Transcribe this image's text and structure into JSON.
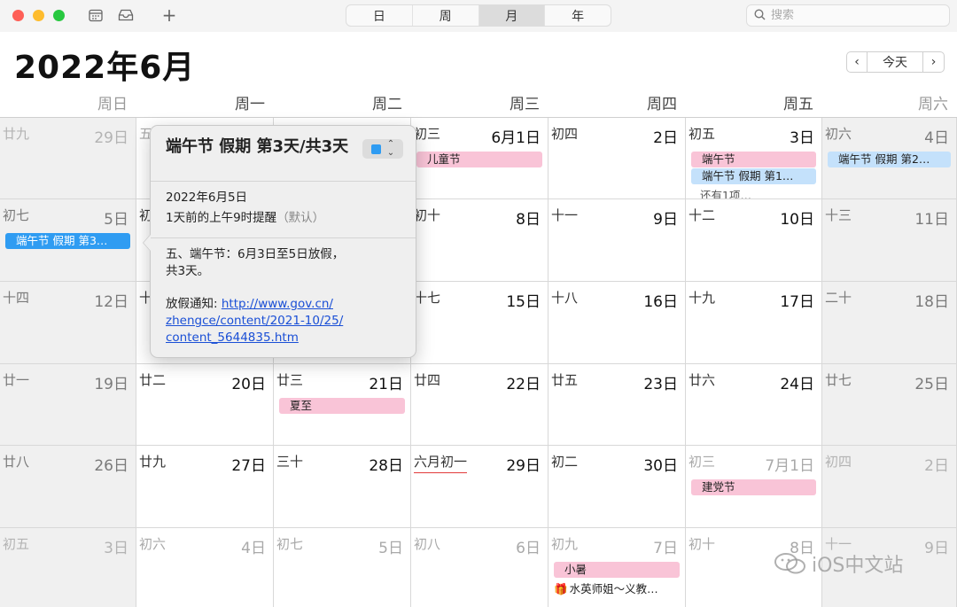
{
  "toolbar": {
    "view_tabs": [
      "日",
      "周",
      "月",
      "年"
    ],
    "active_view": "月",
    "search_placeholder": "搜索",
    "add_label": "+"
  },
  "header": {
    "month_title": "2022年6月",
    "today_label": "今天",
    "prev_label": "‹",
    "next_label": "›"
  },
  "weekdays": [
    "周日",
    "周一",
    "周二",
    "周三",
    "周四",
    "周五",
    "周六"
  ],
  "weeks": [
    [
      {
        "lunar": "廿九",
        "day": "29日",
        "other": true,
        "events": []
      },
      {
        "lunar": "五",
        "day": "",
        "other": true,
        "events": []
      },
      {
        "lunar": "",
        "day": "",
        "other": true,
        "events": []
      },
      {
        "lunar": "初三",
        "day": "6月1日",
        "events": [
          {
            "title": "儿童节",
            "color": "pink"
          }
        ]
      },
      {
        "lunar": "初四",
        "day": "2日",
        "events": []
      },
      {
        "lunar": "初五",
        "day": "3日",
        "events": [
          {
            "title": "端午节",
            "color": "pink"
          },
          {
            "title": "端午节 假期 第1…",
            "color": "blue"
          }
        ],
        "more": "还有1项…"
      },
      {
        "lunar": "初六",
        "day": "4日",
        "events": [
          {
            "title": "端午节 假期 第2…",
            "color": "blue"
          }
        ]
      }
    ],
    [
      {
        "lunar": "初七",
        "day": "5日",
        "events": [
          {
            "title": "端午节 假期 第3…",
            "color": "solid"
          }
        ]
      },
      {
        "lunar": "初",
        "day": "",
        "events": []
      },
      {
        "lunar": "",
        "day": "",
        "events": []
      },
      {
        "lunar": "初十",
        "day": "8日",
        "events": []
      },
      {
        "lunar": "十一",
        "day": "9日",
        "events": []
      },
      {
        "lunar": "十二",
        "day": "10日",
        "events": []
      },
      {
        "lunar": "十三",
        "day": "11日",
        "events": []
      }
    ],
    [
      {
        "lunar": "十四",
        "day": "12日",
        "events": []
      },
      {
        "lunar": "十",
        "day": "",
        "events": []
      },
      {
        "lunar": "",
        "day": "",
        "events": []
      },
      {
        "lunar": "十七",
        "day": "15日",
        "events": []
      },
      {
        "lunar": "十八",
        "day": "16日",
        "events": []
      },
      {
        "lunar": "十九",
        "day": "17日",
        "events": []
      },
      {
        "lunar": "二十",
        "day": "18日",
        "events": []
      }
    ],
    [
      {
        "lunar": "廿一",
        "day": "19日",
        "events": []
      },
      {
        "lunar": "廿二",
        "day": "20日",
        "events": []
      },
      {
        "lunar": "廿三",
        "day": "21日",
        "events": [
          {
            "title": "夏至",
            "color": "pink"
          }
        ]
      },
      {
        "lunar": "廿四",
        "day": "22日",
        "events": []
      },
      {
        "lunar": "廿五",
        "day": "23日",
        "events": []
      },
      {
        "lunar": "廿六",
        "day": "24日",
        "events": []
      },
      {
        "lunar": "廿七",
        "day": "25日",
        "events": []
      }
    ],
    [
      {
        "lunar": "廿八",
        "day": "26日",
        "events": []
      },
      {
        "lunar": "廿九",
        "day": "27日",
        "events": []
      },
      {
        "lunar": "三十",
        "day": "28日",
        "events": []
      },
      {
        "lunar": "六月初一",
        "day": "29日",
        "marked": true,
        "events": []
      },
      {
        "lunar": "初二",
        "day": "30日",
        "events": []
      },
      {
        "lunar": "初三",
        "day": "7月1日",
        "other": true,
        "events": [
          {
            "title": "建党节",
            "color": "pink"
          }
        ]
      },
      {
        "lunar": "初四",
        "day": "2日",
        "other": true,
        "events": []
      }
    ],
    [
      {
        "lunar": "初五",
        "day": "3日",
        "other": true,
        "events": []
      },
      {
        "lunar": "初六",
        "day": "4日",
        "other": true,
        "events": []
      },
      {
        "lunar": "初七",
        "day": "5日",
        "other": true,
        "events": []
      },
      {
        "lunar": "初八",
        "day": "6日",
        "other": true,
        "events": []
      },
      {
        "lunar": "初九",
        "day": "7日",
        "other": true,
        "events": [
          {
            "title": "小暑",
            "color": "pink"
          }
        ],
        "gift_event": "水英师姐～义教…"
      },
      {
        "lunar": "初十",
        "day": "8日",
        "other": true,
        "events": []
      },
      {
        "lunar": "十一",
        "day": "9日",
        "other": true,
        "events": []
      }
    ]
  ],
  "popover": {
    "title": "端午节 假期 第3天/共3天",
    "date": "2022年6月5日",
    "alert": "1天前的上午9时提醒",
    "alert_default": "（默认）",
    "notes_line1": "五、端午节：6月3日至5日放假，",
    "notes_line2": "共3天。",
    "url_label": "放假通知: ",
    "url_line1": "http://www.gov.cn/",
    "url_line2": "zhengce/content/2021-10/25/",
    "url_line3": "content_5644835.htm",
    "calendar_color": "#2f9cf2"
  },
  "watermark": "iOS中文站",
  "colors": {
    "event_pink": "#f9c4d7",
    "event_blue": "#c4e1fb",
    "event_selected": "#2f9cf2",
    "lunar_mark": "#e23b3b"
  }
}
